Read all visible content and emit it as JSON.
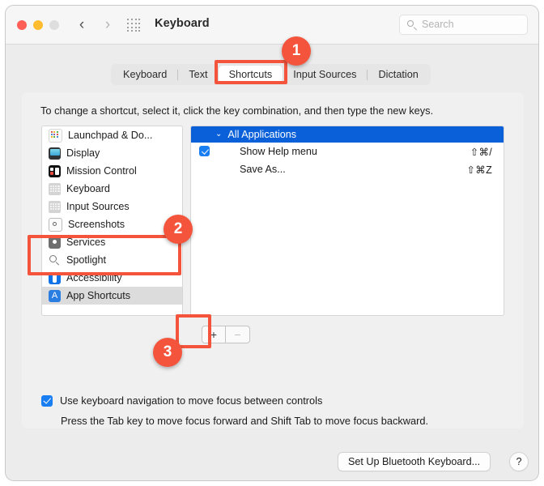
{
  "window": {
    "title": "Keyboard",
    "traffic_lights": [
      "close",
      "minimize",
      "zoom"
    ],
    "nav_back": "‹",
    "nav_forward": "›",
    "grid_icon": "grid-icon"
  },
  "search": {
    "placeholder": "Search",
    "value": ""
  },
  "tabs": [
    {
      "label": "Keyboard",
      "active": false
    },
    {
      "label": "Text",
      "active": false
    },
    {
      "label": "Shortcuts",
      "active": true
    },
    {
      "label": "Input Sources",
      "active": false
    },
    {
      "label": "Dictation",
      "active": false
    }
  ],
  "content": {
    "instruction": "To change a shortcut, select it, click the key combination, and then type the new keys."
  },
  "sidebar": {
    "items": [
      {
        "label": "Launchpad & Do...",
        "icon": "launchpad-icon",
        "selected": false
      },
      {
        "label": "Display",
        "icon": "display-icon",
        "selected": false
      },
      {
        "label": "Mission Control",
        "icon": "mission-control-icon",
        "selected": false
      },
      {
        "label": "Keyboard",
        "icon": "keyboard-icon",
        "selected": false
      },
      {
        "label": "Input Sources",
        "icon": "input-sources-icon",
        "selected": false
      },
      {
        "label": "Screenshots",
        "icon": "screenshots-icon",
        "selected": false
      },
      {
        "label": "Services",
        "icon": "services-icon",
        "selected": false
      },
      {
        "label": "Spotlight",
        "icon": "spotlight-icon",
        "selected": false
      },
      {
        "label": "Accessibility",
        "icon": "accessibility-icon",
        "selected": false
      },
      {
        "label": "App Shortcuts",
        "icon": "app-shortcuts-icon",
        "selected": true
      }
    ]
  },
  "shortcuts_panel": {
    "group_label": "All Applications",
    "group_chevron": "⌄",
    "rows": [
      {
        "name": "Show Help menu",
        "keys": "⇧⌘/",
        "checked": true
      },
      {
        "name": "Save As...",
        "keys": "⇧⌘Z",
        "checked": false
      }
    ]
  },
  "list_buttons": {
    "add_label": "+",
    "remove_label": "−"
  },
  "keyboard_nav": {
    "checkbox_label": "Use keyboard navigation to move focus between controls",
    "checked": true,
    "hint": "Press the Tab key to move focus forward and Shift Tab to move focus backward."
  },
  "footer": {
    "bluetooth_label": "Set Up Bluetooth Keyboard...",
    "help_label": "?"
  },
  "annotations": {
    "accent_color": "#f4543c",
    "badges": [
      {
        "number": "1",
        "target": "shortcuts-tab"
      },
      {
        "number": "2",
        "target": "app-shortcuts-sidebar-item"
      },
      {
        "number": "3",
        "target": "add-shortcut-button"
      }
    ]
  }
}
